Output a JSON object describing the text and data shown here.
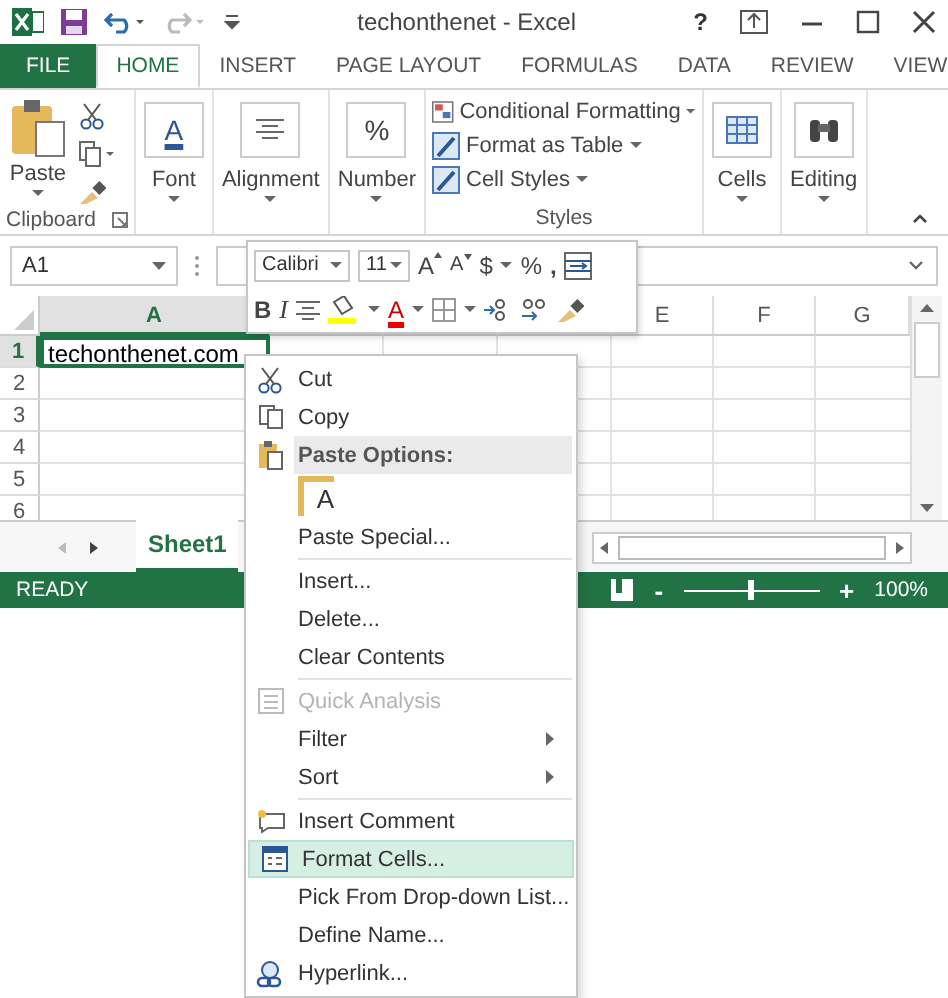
{
  "title_bar": {
    "title": "techonthenet - Excel",
    "help": "?"
  },
  "ribbon": {
    "tabs": [
      {
        "label": "FILE",
        "kind": "file",
        "selected": false
      },
      {
        "label": "HOME",
        "kind": "tab",
        "selected": true
      },
      {
        "label": "INSERT",
        "kind": "tab",
        "selected": false
      },
      {
        "label": "PAGE LAYOUT",
        "kind": "tab",
        "selected": false
      },
      {
        "label": "FORMULAS",
        "kind": "tab",
        "selected": false
      },
      {
        "label": "DATA",
        "kind": "tab",
        "selected": false
      },
      {
        "label": "REVIEW",
        "kind": "tab",
        "selected": false
      },
      {
        "label": "VIEW",
        "kind": "tab",
        "selected": false
      }
    ],
    "groups": [
      {
        "kind": "clipboard",
        "label": "Clipboard",
        "paste": "Paste"
      },
      {
        "kind": "collapsed",
        "name": "Font",
        "glyph": "A"
      },
      {
        "kind": "collapsed",
        "name": "Alignment"
      },
      {
        "kind": "collapsed",
        "name": "Number",
        "glyph": "%"
      },
      {
        "kind": "styles",
        "label": "Styles",
        "commands": [
          "Conditional Formatting",
          "Format as Table",
          "Cell Styles"
        ]
      },
      {
        "kind": "collapsed",
        "name": "Cells"
      },
      {
        "kind": "collapsed",
        "name": "Editing"
      }
    ]
  },
  "name_box": "A1",
  "mini_toolbar": {
    "font": "Calibri",
    "size": "11",
    "grow": "A",
    "shrink": "A",
    "currency": "$",
    "percent": "%",
    "comma": ",",
    "bold": "B",
    "italic": "I",
    "font_color": "A"
  },
  "column_headers": [
    "A",
    "E",
    "F",
    "G"
  ],
  "rows": [
    {
      "number": "1",
      "cell": "techonthenet.com",
      "selected": true
    },
    {
      "number": "2"
    },
    {
      "number": "3"
    },
    {
      "number": "4"
    },
    {
      "number": "5"
    },
    {
      "number": "6"
    }
  ],
  "sheet_tabs": [
    {
      "label": "Sheet1",
      "selected": true
    }
  ],
  "status_bar": {
    "status": "READY",
    "zoom_minus": "-",
    "zoom_plus": "+",
    "zoom": "100%",
    "level": 0.5
  },
  "context_menu": [
    {
      "kind": "item",
      "label": "Cut"
    },
    {
      "kind": "item",
      "label": "Copy"
    },
    {
      "kind": "header",
      "label": "Paste Options:"
    },
    {
      "kind": "paste",
      "glyph": "A"
    },
    {
      "kind": "item",
      "label": "Paste Special..."
    },
    {
      "kind": "item",
      "label": "Insert...",
      "separator_before": true
    },
    {
      "kind": "item",
      "label": "Delete..."
    },
    {
      "kind": "item",
      "label": "Clear Contents"
    },
    {
      "kind": "item",
      "label": "Quick Analysis",
      "disabled": true,
      "separator_before": true
    },
    {
      "kind": "item",
      "label": "Filter",
      "submenu": true
    },
    {
      "kind": "item",
      "label": "Sort",
      "submenu": true
    },
    {
      "kind": "item",
      "label": "Insert Comment",
      "separator_before": true
    },
    {
      "kind": "item",
      "label": "Format Cells...",
      "selected": true
    },
    {
      "kind": "item",
      "label": "Pick From Drop-down List...",
      "selected": false
    },
    {
      "kind": "item",
      "label": "Define Name..."
    },
    {
      "kind": "item",
      "label": "Hyperlink..."
    }
  ]
}
